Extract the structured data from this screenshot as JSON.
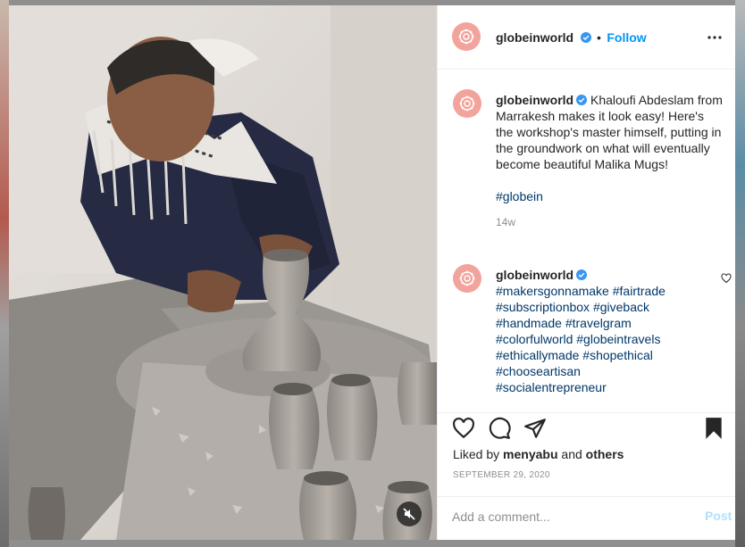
{
  "post": {
    "author": "globeinworld",
    "follow_label": "Follow",
    "dot": "•",
    "caption": {
      "author": "globeinworld",
      "text": "Khaloufi Abdeslam from Marrakesh makes it look easy! Here's the workshop's master himself, putting in the groundwork on what will eventually become beautiful Malika Mugs!",
      "hashtag": "#globein",
      "time": "14w"
    },
    "comment": {
      "author": "globeinworld",
      "hashtags": [
        "#makersgonnamake",
        "#fairtrade",
        "#subscriptionbox",
        "#giveback",
        "#handmade",
        "#travelgram",
        "#colorfulworld",
        "#globeintravels",
        "#ethicallymade",
        "#shopethical",
        "#chooseartisan",
        "#socialentrepreneur"
      ]
    },
    "likes": {
      "prefix": "Liked by",
      "user": "menyabu",
      "joiner": "and",
      "others": "others"
    },
    "date": "SEPTEMBER 29, 2020",
    "add_comment_placeholder": "Add a comment...",
    "post_label": "Post"
  },
  "icons": {
    "more": "more-options-icon",
    "verified": "verified-badge-icon",
    "like": "heart-icon",
    "comment": "comment-icon",
    "share": "share-icon",
    "save": "bookmark-icon",
    "mute": "muted-speaker-icon",
    "avatar": "globein-logo-icon"
  },
  "colors": {
    "accent": "#0095f6",
    "avatar": "#f2a39b",
    "hashtag": "#00376b",
    "post_disabled": "#b2dffc"
  }
}
